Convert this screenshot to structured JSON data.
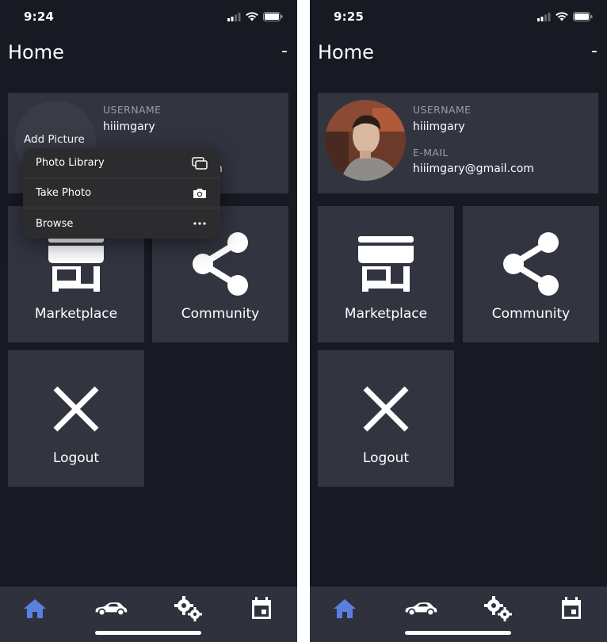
{
  "left": {
    "status": {
      "time": "9:24"
    },
    "header": {
      "title": "Home",
      "menu": "-"
    },
    "profile": {
      "add_picture": "Add Picture",
      "username_label": "USERNAME",
      "username_value": "hiiimgary",
      "email_partial": "n"
    },
    "context_menu": {
      "items": [
        {
          "label": "Photo Library",
          "icon": "photo-library-icon"
        },
        {
          "label": "Take Photo",
          "icon": "camera-icon"
        },
        {
          "label": "Browse",
          "icon": "more-icon"
        }
      ]
    },
    "tiles": {
      "marketplace": "Marketplace",
      "community": "Community",
      "logout": "Logout"
    }
  },
  "right": {
    "status": {
      "time": "9:25"
    },
    "header": {
      "title": "Home",
      "menu": "-"
    },
    "profile": {
      "username_label": "USERNAME",
      "username_value": "hiiimgary",
      "email_label": "E-MAIL",
      "email_value": "hiiimgary@gmail.com"
    },
    "tiles": {
      "marketplace": "Marketplace",
      "community": "Community",
      "logout": "Logout"
    }
  },
  "tabbar": {
    "tabs": [
      "home-icon",
      "car-icon",
      "settings-icon",
      "calendar-icon"
    ],
    "active": "home-icon"
  },
  "colors": {
    "background": "#171a23",
    "card": "#323540",
    "tabbar": "#2f323d",
    "accent": "#5b7fe0"
  }
}
